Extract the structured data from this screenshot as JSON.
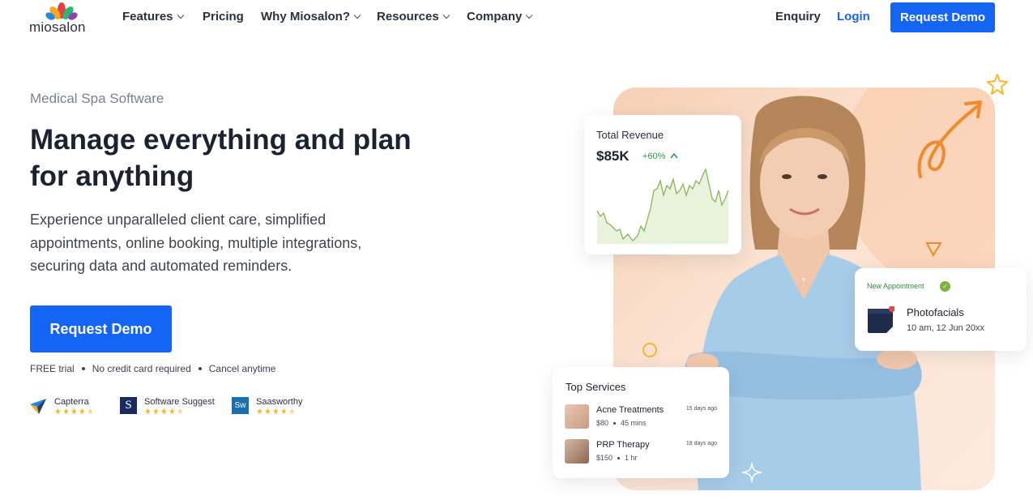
{
  "nav": {
    "logo_text": "miosalon",
    "items": [
      {
        "label": "Features",
        "has_dropdown": true
      },
      {
        "label": "Pricing",
        "has_dropdown": false
      },
      {
        "label": "Why Miosalon?",
        "has_dropdown": true
      },
      {
        "label": "Resources",
        "has_dropdown": true
      },
      {
        "label": "Company",
        "has_dropdown": true
      }
    ],
    "enquiry": "Enquiry",
    "login": "Login",
    "cta": "Request Demo"
  },
  "hero": {
    "eyebrow": "Medical Spa Software",
    "headline": "Manage everything and plan for anything",
    "subtext": "Experience unparalleled client care, simplified appointments, online booking, multiple integrations, securing data and automated reminders.",
    "cta": "Request Demo",
    "perks": [
      "FREE trial",
      "No credit card required",
      "Cancel anytime"
    ],
    "reviews": [
      {
        "name": "Capterra",
        "icon": "capterra-icon",
        "rating": 4.5
      },
      {
        "name": "Software Suggest",
        "icon": "software-suggest-icon",
        "rating": 4.5
      },
      {
        "name": "Saasworthy",
        "icon": "saasworthy-icon",
        "rating": 4.5
      }
    ]
  },
  "revenue_card": {
    "title": "Total Revenue",
    "value": "$85K",
    "delta": "+60%",
    "trend_icon": "arrow-up-icon"
  },
  "appointment_card": {
    "tag": "New Appointment",
    "service": "Photofacials",
    "when": "10 am, 12 Jun 20xx"
  },
  "services_card": {
    "title": "Top Services",
    "items": [
      {
        "name": "Acne Treatments",
        "price": "$80",
        "duration": "45 mins",
        "ago": "15 days ago"
      },
      {
        "name": "PRP Therapy",
        "price": "$150",
        "duration": "1 hr",
        "ago": "18 days ago"
      }
    ]
  },
  "colors": {
    "primary": "#1565f5",
    "success": "#2e9d4a",
    "star": "#f5b82a",
    "accent_orange": "#f08a2a"
  }
}
